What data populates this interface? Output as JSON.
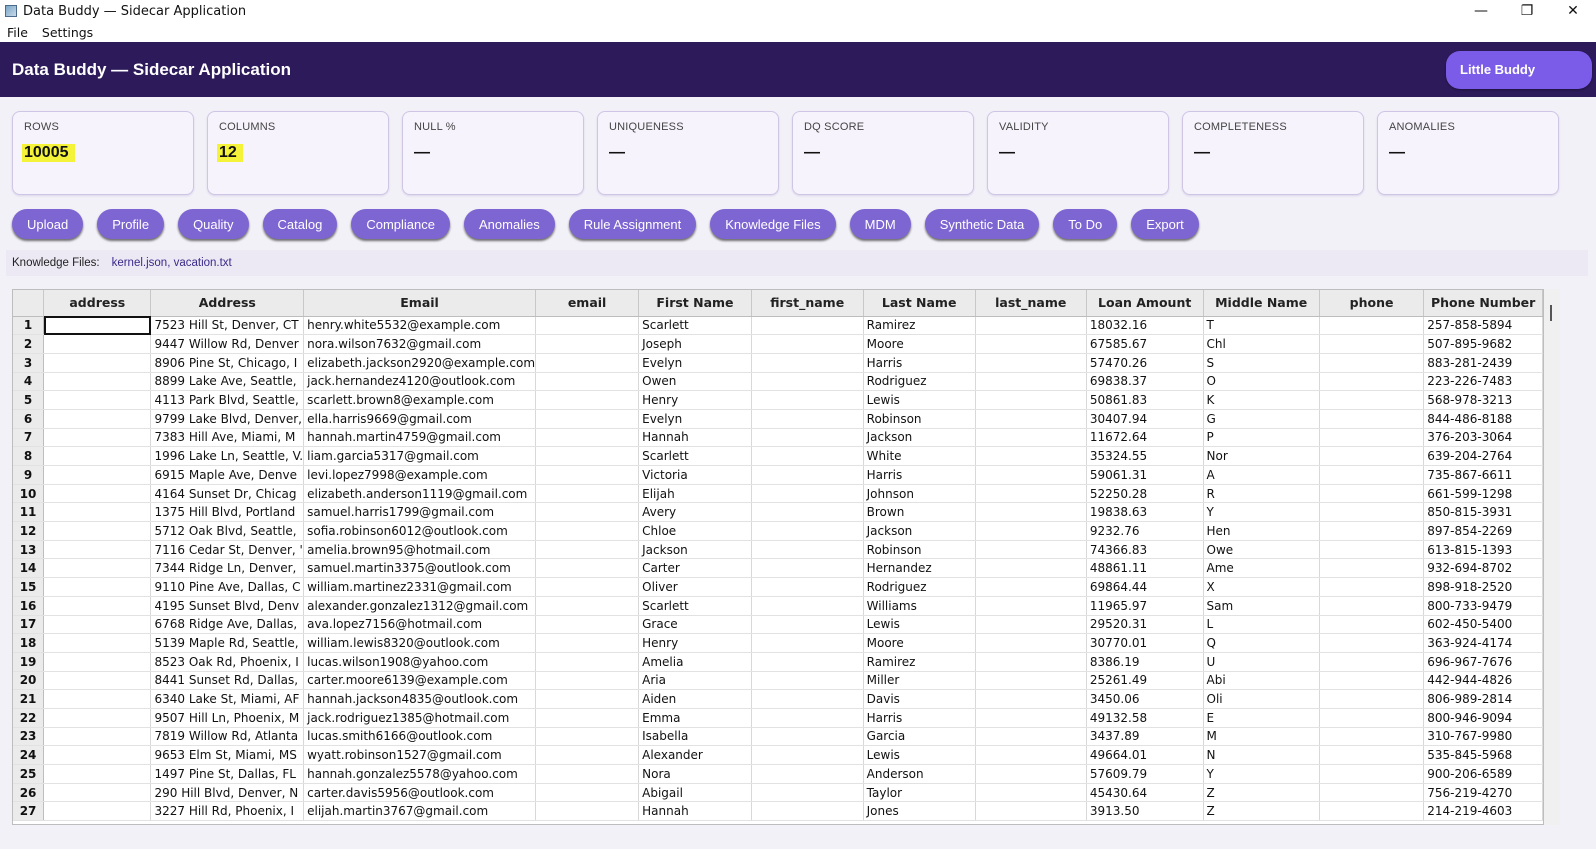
{
  "window": {
    "title": "Data Buddy — Sidecar Application",
    "minimize": "—",
    "maximize": "❐",
    "close": "✕"
  },
  "menu": {
    "items": [
      "File",
      "Settings"
    ]
  },
  "header": {
    "title": "Data Buddy — Sidecar Application",
    "buddy_button": "Little Buddy"
  },
  "metrics": [
    {
      "label": "ROWS",
      "value": "10005"
    },
    {
      "label": "COLUMNS",
      "value": "12"
    },
    {
      "label": "NULL %",
      "value": "—"
    },
    {
      "label": "UNIQUENESS",
      "value": "—"
    },
    {
      "label": "DQ SCORE",
      "value": "—"
    },
    {
      "label": "VALIDITY",
      "value": "—"
    },
    {
      "label": "COMPLETENESS",
      "value": "—"
    },
    {
      "label": "ANOMALIES",
      "value": "—"
    }
  ],
  "nav": [
    "Upload",
    "Profile",
    "Quality",
    "Catalog",
    "Compliance",
    "Anomalies",
    "Rule Assignment",
    "Knowledge Files",
    "MDM",
    "Synthetic Data",
    "To Do",
    "Export"
  ],
  "knowledge": {
    "label": "Knowledge Files:",
    "value": "kernel.json, vacation.txt"
  },
  "colors": {
    "header_bg": "#2c1a5a",
    "accent": "#7b5ce8",
    "nav_button": "#7d65d2",
    "highlight": "#f5f23a"
  },
  "table": {
    "columns": [
      "address",
      "Address",
      "Email",
      "email",
      "First Name",
      "first_name",
      "Last Name",
      "last_name",
      "Loan Amount",
      "Middle Name",
      "phone",
      "Phone Number"
    ],
    "rows": [
      [
        "1",
        "",
        "7523 Hill St, Denver, CT",
        "henry.white5532@example.com",
        "",
        "Scarlett",
        "",
        "Ramirez",
        "",
        "18032.16",
        "T",
        "",
        "257-858-5894"
      ],
      [
        "2",
        "",
        "9447 Willow Rd, Denver",
        "nora.wilson7632@gmail.com",
        "",
        "Joseph",
        "",
        "Moore",
        "",
        "67585.67",
        "Chl",
        "",
        "507-895-9682"
      ],
      [
        "3",
        "",
        "8906 Pine St, Chicago, I",
        "elizabeth.jackson2920@example.com",
        "",
        "Evelyn",
        "",
        "Harris",
        "",
        "57470.26",
        "S",
        "",
        "883-281-2439"
      ],
      [
        "4",
        "",
        "8899 Lake Ave, Seattle,",
        "jack.hernandez4120@outlook.com",
        "",
        "Owen",
        "",
        "Rodriguez",
        "",
        "69838.37",
        "O",
        "",
        "223-226-7483"
      ],
      [
        "5",
        "",
        "4113 Park Blvd, Seattle,",
        "scarlett.brown8@example.com",
        "",
        "Henry",
        "",
        "Lewis",
        "",
        "50861.83",
        "K",
        "",
        "568-978-3213"
      ],
      [
        "6",
        "",
        "9799 Lake Blvd, Denver,",
        "ella.harris9669@gmail.com",
        "",
        "Evelyn",
        "",
        "Robinson",
        "",
        "30407.94",
        "G",
        "",
        "844-486-8188"
      ],
      [
        "7",
        "",
        "7383 Hill Ave, Miami, M",
        "hannah.martin4759@gmail.com",
        "",
        "Hannah",
        "",
        "Jackson",
        "",
        "11672.64",
        "P",
        "",
        "376-203-3064"
      ],
      [
        "8",
        "",
        "1996 Lake Ln, Seattle, V.",
        "liam.garcia5317@gmail.com",
        "",
        "Scarlett",
        "",
        "White",
        "",
        "35324.55",
        "Nor",
        "",
        "639-204-2764"
      ],
      [
        "9",
        "",
        "6915 Maple Ave, Denve",
        "levi.lopez7998@example.com",
        "",
        "Victoria",
        "",
        "Harris",
        "",
        "59061.31",
        "A",
        "",
        "735-867-6611"
      ],
      [
        "10",
        "",
        "4164 Sunset Dr, Chicag",
        "elizabeth.anderson1119@gmail.com",
        "",
        "Elijah",
        "",
        "Johnson",
        "",
        "52250.28",
        "R",
        "",
        "661-599-1298"
      ],
      [
        "11",
        "",
        "1375 Hill Blvd, Portland",
        "samuel.harris1799@gmail.com",
        "",
        "Avery",
        "",
        "Brown",
        "",
        "19838.63",
        "Y",
        "",
        "850-815-3931"
      ],
      [
        "12",
        "",
        "5712 Oak Blvd, Seattle,",
        "sofia.robinson6012@outlook.com",
        "",
        "Chloe",
        "",
        "Jackson",
        "",
        "9232.76",
        "Hen",
        "",
        "897-854-2269"
      ],
      [
        "13",
        "",
        "7116 Cedar St, Denver, '",
        "amelia.brown95@hotmail.com",
        "",
        "Jackson",
        "",
        "Robinson",
        "",
        "74366.83",
        "Owe",
        "",
        "613-815-1393"
      ],
      [
        "14",
        "",
        "7344 Ridge Ln, Denver,",
        "samuel.martin3375@outlook.com",
        "",
        "Carter",
        "",
        "Hernandez",
        "",
        "48861.11",
        "Ame",
        "",
        "932-694-8702"
      ],
      [
        "15",
        "",
        "9110 Pine Ave, Dallas, C",
        "william.martinez2331@gmail.com",
        "",
        "Oliver",
        "",
        "Rodriguez",
        "",
        "69864.44",
        "X",
        "",
        "898-918-2520"
      ],
      [
        "16",
        "",
        "4195 Sunset Blvd, Denv",
        "alexander.gonzalez1312@gmail.com",
        "",
        "Scarlett",
        "",
        "Williams",
        "",
        "11965.97",
        "Sam",
        "",
        "800-733-9479"
      ],
      [
        "17",
        "",
        "6768 Ridge Ave, Dallas,",
        "ava.lopez7156@hotmail.com",
        "",
        "Grace",
        "",
        "Lewis",
        "",
        "29520.31",
        "L",
        "",
        "602-450-5400"
      ],
      [
        "18",
        "",
        "5139 Maple Rd, Seattle,",
        "william.lewis8320@outlook.com",
        "",
        "Henry",
        "",
        "Moore",
        "",
        "30770.01",
        "Q",
        "",
        "363-924-4174"
      ],
      [
        "19",
        "",
        "8523 Oak Rd, Phoenix, I",
        "lucas.wilson1908@yahoo.com",
        "",
        "Amelia",
        "",
        "Ramirez",
        "",
        "8386.19",
        "U",
        "",
        "696-967-7676"
      ],
      [
        "20",
        "",
        "8441 Sunset Rd, Dallas,",
        "carter.moore6139@example.com",
        "",
        "Aria",
        "",
        "Miller",
        "",
        "25261.49",
        "Abi",
        "",
        "442-944-4826"
      ],
      [
        "21",
        "",
        "6340 Lake St, Miami, AF",
        "hannah.jackson4835@outlook.com",
        "",
        "Aiden",
        "",
        "Davis",
        "",
        "3450.06",
        "Oli",
        "",
        "806-989-2814"
      ],
      [
        "22",
        "",
        "9507 Hill Ln, Phoenix, M",
        "jack.rodriguez1385@hotmail.com",
        "",
        "Emma",
        "",
        "Harris",
        "",
        "49132.58",
        "E",
        "",
        "800-946-9094"
      ],
      [
        "23",
        "",
        "7819 Willow Rd, Atlanta",
        "lucas.smith6166@outlook.com",
        "",
        "Isabella",
        "",
        "Garcia",
        "",
        "3437.89",
        "M",
        "",
        "310-767-9980"
      ],
      [
        "24",
        "",
        "9653 Elm St, Miami, MS",
        "wyatt.robinson1527@gmail.com",
        "",
        "Alexander",
        "",
        "Lewis",
        "",
        "49664.01",
        "N",
        "",
        "535-845-5968"
      ],
      [
        "25",
        "",
        "1497 Pine St, Dallas, FL",
        "hannah.gonzalez5578@yahoo.com",
        "",
        "Nora",
        "",
        "Anderson",
        "",
        "57609.79",
        "Y",
        "",
        "900-206-6589"
      ],
      [
        "26",
        "",
        "290 Hill Blvd, Denver, N",
        "carter.davis5956@outlook.com",
        "",
        "Abigail",
        "",
        "Taylor",
        "",
        "45430.64",
        "Z",
        "",
        "756-219-4270"
      ],
      [
        "27",
        "",
        "3227 Hill Rd, Phoenix, I",
        "elijah.martin3767@gmail.com",
        "",
        "Hannah",
        "",
        "Jones",
        "",
        "3913.50",
        "Z",
        "",
        "214-219-4603"
      ]
    ]
  }
}
